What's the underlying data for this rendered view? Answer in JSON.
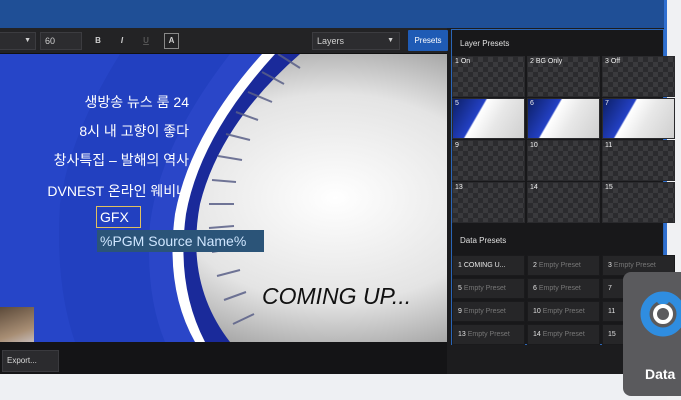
{
  "toolbar": {
    "font_size": "60",
    "bold_label": "B",
    "italic_label": "I",
    "underline_label": "U",
    "color_label": "A",
    "layers_select": "Layers",
    "presets_label": "Presets"
  },
  "canvas": {
    "lines": [
      "생방송 뉴스 룸 24",
      "8시 내 고향이 좋다",
      "창사특집 – 발해의 역사",
      "DVNEST 온라인 웨비나"
    ],
    "gfx_box": "GFX 1",
    "pgm_box": "%PGM Source Name%",
    "coming_up": "COMING UP..."
  },
  "bottom": {
    "export_label": "Export..."
  },
  "layer_presets": {
    "title": "Layer Presets",
    "cells": [
      {
        "label": "1 On",
        "filled": false
      },
      {
        "label": "2 BG Only",
        "filled": false
      },
      {
        "label": "3 Off",
        "filled": false
      },
      {
        "label": "5",
        "filled": true
      },
      {
        "label": "6",
        "filled": true
      },
      {
        "label": "7",
        "filled": true
      },
      {
        "label": "9",
        "filled": false
      },
      {
        "label": "10",
        "filled": false
      },
      {
        "label": "11",
        "filled": false
      },
      {
        "label": "13",
        "filled": false
      },
      {
        "label": "14",
        "filled": false
      },
      {
        "label": "15",
        "filled": false
      }
    ]
  },
  "data_presets": {
    "title": "Data Presets",
    "cells": [
      {
        "num": "1",
        "name": "COMING U...",
        "active": true
      },
      {
        "num": "2",
        "name": "Empty Preset",
        "active": false
      },
      {
        "num": "3",
        "name": "Empty Preset",
        "active": false
      },
      {
        "num": "5",
        "name": "Empty Preset",
        "active": false
      },
      {
        "num": "6",
        "name": "Empty Preset",
        "active": false
      },
      {
        "num": "7",
        "name": "",
        "active": false
      },
      {
        "num": "9",
        "name": "Empty Preset",
        "active": false
      },
      {
        "num": "10",
        "name": "Empty Preset",
        "active": false
      },
      {
        "num": "11",
        "name": "",
        "active": false
      },
      {
        "num": "13",
        "name": "Empty Preset",
        "active": false
      },
      {
        "num": "14",
        "name": "Empty Preset",
        "active": false
      },
      {
        "num": "15",
        "name": "",
        "active": false
      }
    ]
  },
  "data_logo": {
    "label": "Data",
    "icon": "datalink-icon"
  },
  "colors": {
    "accent": "#1f5bb5",
    "brand_blue": "#2340c4"
  }
}
